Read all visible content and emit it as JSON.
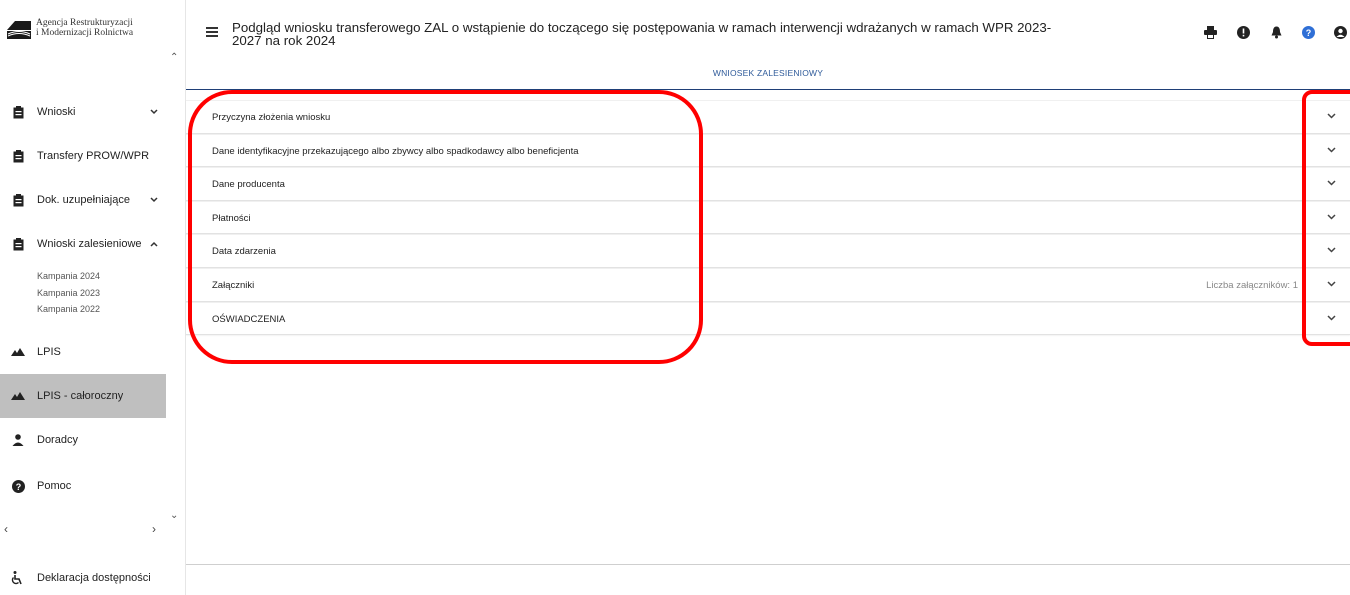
{
  "logo": {
    "line1": "Agencja Restrukturyzacji",
    "line2": "i Modernizacji Rolnictwa",
    "mark_text": "ARiMR"
  },
  "sidebar": {
    "items": [
      {
        "label": "Wnioski",
        "icon": "clipboard-icon",
        "chevron": "⌄"
      },
      {
        "label": "Transfery PROW/WPR",
        "icon": "clipboard-icon"
      },
      {
        "label": "Dok. uzupełniające",
        "icon": "clipboard-icon",
        "chevron": "⌄"
      },
      {
        "label": "Wnioski zalesieniowe",
        "icon": "clipboard-icon",
        "chevron": "⌃"
      },
      {
        "label": "LPIS",
        "icon": "mountain-icon"
      },
      {
        "label": "LPIS - całoroczny",
        "icon": "mountain-icon"
      },
      {
        "label": "Doradcy",
        "icon": "person-icon"
      },
      {
        "label": "Pomoc",
        "icon": "help-icon"
      }
    ],
    "subitems": [
      "Kampania 2024",
      "Kampania 2023",
      "Kampania 2022"
    ],
    "footer": {
      "label": "Deklaracja dostępności",
      "icon": "wheelchair-icon"
    }
  },
  "header": {
    "title": "Podgląd wniosku transferowego ZAL o wstąpienie do toczącego się postępowania w ramach interwencji wdrażanych w ramach WPR 2023-2027 na rok 2024",
    "icons": [
      "print-icon",
      "alert-icon",
      "bell-icon",
      "help-icon",
      "account-icon"
    ]
  },
  "tab": {
    "label": "WNIOSEK ZALESIENIOWY"
  },
  "panels": [
    {
      "label": "Przyczyna złożenia wniosku"
    },
    {
      "label": "Dane identyfikacyjne przekazującego albo zbywcy albo spadkodawcy albo beneficjenta"
    },
    {
      "label": "Dane producenta"
    },
    {
      "label": "Płatności"
    },
    {
      "label": "Data zdarzenia"
    },
    {
      "label": "Załączniki",
      "info": "Liczba załączników: 1"
    },
    {
      "label": "OŚWIADCZENIA"
    }
  ],
  "colors": {
    "accent": "#2f5b9a",
    "highlight": "#ff0000",
    "active_nav": "#bfbfbf",
    "help_icon": "#2f6fd6"
  }
}
